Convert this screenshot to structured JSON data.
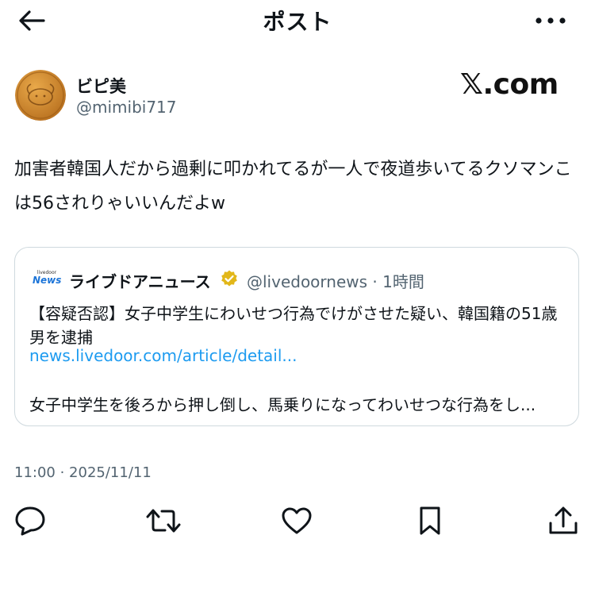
{
  "header": {
    "title": "ポスト",
    "back_icon": "arrow-left-icon",
    "more_icon": "more-horizontal-icon"
  },
  "author": {
    "display_name": "ビピ美",
    "handle": "@mimibi717"
  },
  "watermark": "𝕏.com",
  "post": {
    "text": "加害者韓国人だから過剰に叩かれてるが一人で夜道歩いてるクソマンこは56されりゃいいんだよw",
    "timestamp": "11:00 · 2025/11/11"
  },
  "quote": {
    "logo_top": "livedoor",
    "logo_bottom": "News",
    "name": "ライブドアニュース",
    "handle_time": "@livedoornews · 1時間",
    "text": "【容疑否認】女子中学生にわいせつ行為でけがさせた疑い、韓国籍の51歳男を逮捕",
    "link": "news.livedoor.com/article/detail...",
    "excerpt": "女子中学生を後ろから押し倒し、馬乗りになってわいせつな行為をし..."
  },
  "actions": [
    "reply-icon",
    "repost-icon",
    "like-icon",
    "bookmark-icon",
    "share-icon"
  ],
  "colors": {
    "text": "#0f1419",
    "secondary": "#536471",
    "link": "#1d9bf0",
    "border": "#cfd9de",
    "badge": "#e2b719",
    "avatar": "#c98a2e"
  }
}
